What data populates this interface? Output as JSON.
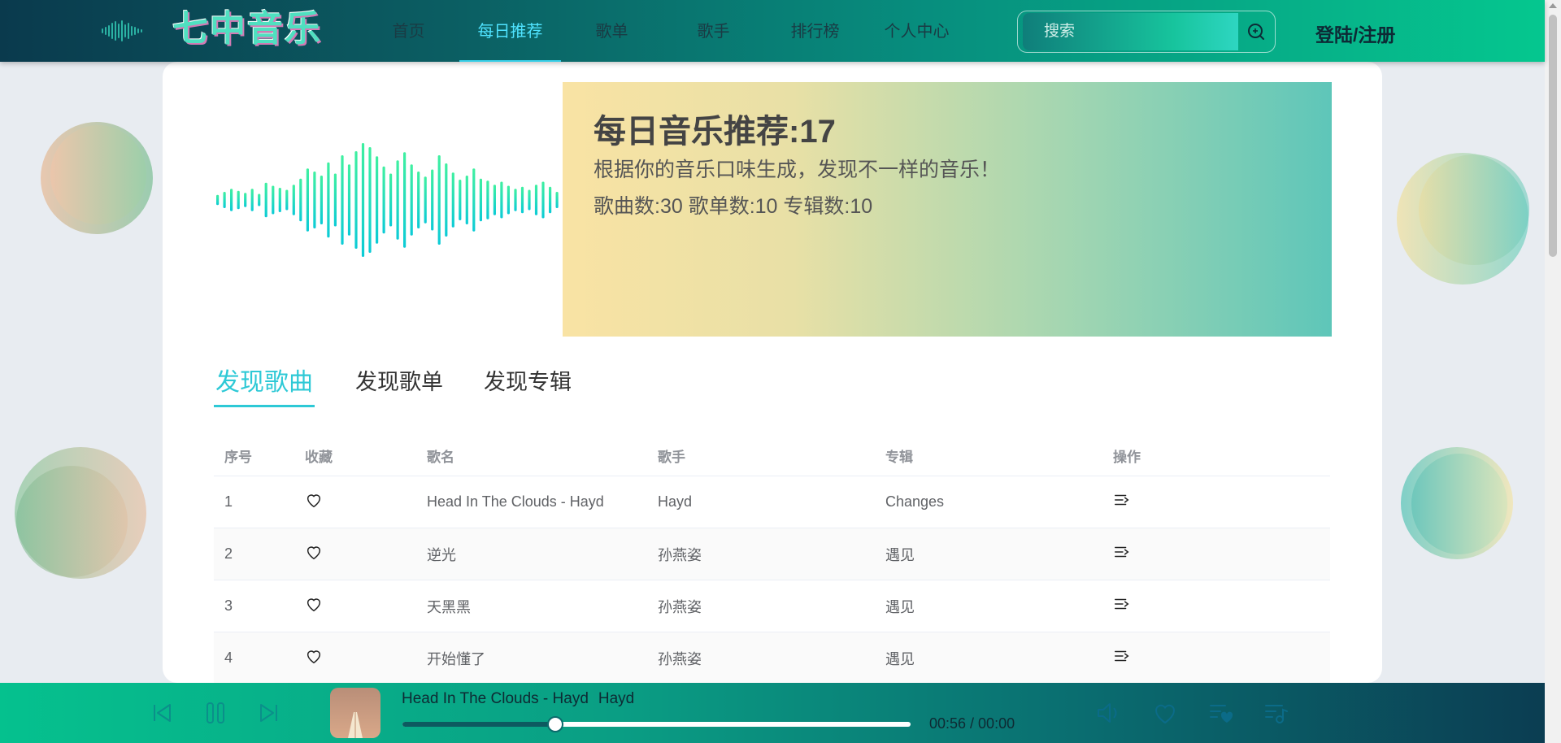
{
  "header": {
    "brand": "七中音乐",
    "nav": [
      "首页",
      "每日推荐",
      "歌单",
      "歌手",
      "排行榜",
      "个人中心"
    ],
    "active_nav": 1,
    "search_placeholder": "搜索",
    "login": "登陆/注册"
  },
  "banner": {
    "title": "每日音乐推荐:17",
    "subtitle": "根据你的音乐口味生成，发现不一样的音乐！",
    "stats": "歌曲数:30 歌单数:10 专辑数:10"
  },
  "tabs": [
    "发现歌曲",
    "发现歌单",
    "发现专辑"
  ],
  "active_tab": 0,
  "table": {
    "columns": [
      "序号",
      "收藏",
      "歌名",
      "歌手",
      "专辑",
      "操作"
    ],
    "rows": [
      {
        "index": "1",
        "name": "Head In The Clouds - Hayd",
        "artist": "Hayd",
        "album": "Changes"
      },
      {
        "index": "2",
        "name": "逆光",
        "artist": "孙燕姿",
        "album": "遇见"
      },
      {
        "index": "3",
        "name": "天黑黑",
        "artist": "孙燕姿",
        "album": "遇见"
      },
      {
        "index": "4",
        "name": "开始懂了",
        "artist": "孙燕姿",
        "album": "遇见"
      }
    ]
  },
  "player": {
    "song": "Head In The Clouds - Hayd",
    "artist": "Hayd",
    "time": "00:56 / 00:00",
    "progress": 0.3
  },
  "colors": {
    "accent": "#2ec9d6",
    "header_start": "#0a3a4d",
    "header_end": "#05c78f"
  }
}
